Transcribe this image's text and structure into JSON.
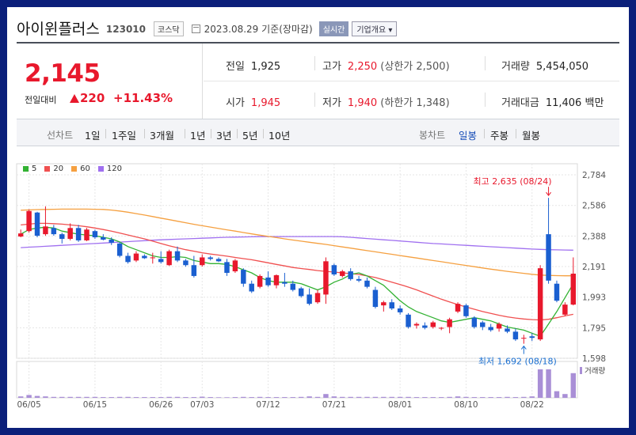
{
  "stock": {
    "name": "아이윈플러스",
    "code": "123010",
    "market": "코스닥",
    "date": "2023.08.29",
    "basis": "기준(장마감)",
    "live_label": "실시간",
    "info_label": "기업개요"
  },
  "price": {
    "current": "2,145",
    "change_label": "전일대비",
    "change": "220",
    "change_pct": "+11.43%"
  },
  "stats": {
    "prev_label": "전일",
    "prev": "1,925",
    "high_label": "고가",
    "high": "2,250",
    "upper_limit": "(상한가 2,500)",
    "volume_label": "거래량",
    "volume": "5,454,050",
    "open_label": "시가",
    "open": "1,945",
    "low_label": "저가",
    "low": "1,940",
    "lower_limit": "(하한가 1,348)",
    "amount_label": "거래대금",
    "amount": "11,406",
    "amount_unit": "백만"
  },
  "periods": {
    "line_label": "선차트",
    "line_items": [
      "1일",
      "1주일",
      "3개월",
      "1년",
      "3년",
      "5년",
      "10년"
    ],
    "candle_label": "봉차트",
    "candle_items": [
      "일봉",
      "주봉",
      "월봉"
    ],
    "active": "일봉"
  },
  "chart_data": {
    "type": "candlestick",
    "x_ticks": [
      "06/05",
      "06/15",
      "06/26",
      "07/03",
      "07/12",
      "07/21",
      "08/01",
      "08/10",
      "08/22"
    ],
    "x_tick_index": [
      1,
      9,
      17,
      22,
      30,
      38,
      46,
      54,
      62
    ],
    "y_ticks": [
      1598,
      1795,
      1993,
      2191,
      2388,
      2586,
      2784
    ],
    "ylim": [
      1598,
      2784
    ],
    "legend": [
      {
        "name": "5",
        "color": "#33b233"
      },
      {
        "name": "20",
        "color": "#f05050"
      },
      {
        "name": "60",
        "color": "#f5a040"
      },
      {
        "name": "120",
        "color": "#a070f0"
      }
    ],
    "annotations": {
      "high_label": "최고 2,635 (08/24)",
      "low_label": "최저 1,692 (08/18)",
      "high_color": "#e8182c",
      "low_color": "#1a6fd0"
    },
    "volume_label": "거래량",
    "up_color": "#e8182c",
    "down_color": "#1a5fd0",
    "candles": [
      [
        2385,
        2430,
        2380,
        2405
      ],
      [
        2420,
        2560,
        2410,
        2550
      ],
      [
        2540,
        2545,
        2380,
        2390
      ],
      [
        2400,
        2580,
        2390,
        2450
      ],
      [
        2440,
        2460,
        2390,
        2400
      ],
      [
        2400,
        2410,
        2340,
        2370
      ],
      [
        2370,
        2470,
        2360,
        2440
      ],
      [
        2440,
        2460,
        2350,
        2360
      ],
      [
        2360,
        2440,
        2355,
        2430
      ],
      [
        2420,
        2430,
        2370,
        2380
      ],
      [
        2380,
        2400,
        2360,
        2365
      ],
      [
        2365,
        2380,
        2330,
        2345
      ],
      [
        2340,
        2350,
        2250,
        2260
      ],
      [
        2260,
        2280,
        2210,
        2220
      ],
      [
        2230,
        2290,
        2220,
        2275
      ],
      [
        2260,
        2270,
        2240,
        2245
      ],
      [
        2245,
        2280,
        2210,
        2250
      ],
      [
        2240,
        2290,
        2210,
        2220
      ],
      [
        2200,
        2300,
        2195,
        2290
      ],
      [
        2290,
        2320,
        2220,
        2230
      ],
      [
        2230,
        2240,
        2190,
        2200
      ],
      [
        2200,
        2260,
        2120,
        2130
      ],
      [
        2200,
        2270,
        2190,
        2250
      ],
      [
        2250,
        2260,
        2230,
        2240
      ],
      [
        2240,
        2250,
        2220,
        2225
      ],
      [
        2220,
        2240,
        2130,
        2150
      ],
      [
        2160,
        2240,
        2150,
        2230
      ],
      [
        2170,
        2180,
        2060,
        2080
      ],
      [
        2080,
        2100,
        2020,
        2030
      ],
      [
        2060,
        2140,
        2050,
        2130
      ],
      [
        2120,
        2160,
        2060,
        2070
      ],
      [
        2070,
        2140,
        2050,
        2135
      ],
      [
        2090,
        2150,
        2060,
        2080
      ],
      [
        2080,
        2100,
        2030,
        2040
      ],
      [
        2050,
        2060,
        1990,
        2000
      ],
      [
        2010,
        2050,
        1940,
        1950
      ],
      [
        1960,
        2040,
        1950,
        2020
      ],
      [
        2010,
        2250,
        1950,
        2225
      ],
      [
        2200,
        2210,
        2130,
        2140
      ],
      [
        2130,
        2170,
        2120,
        2160
      ],
      [
        2160,
        2180,
        2100,
        2110
      ],
      [
        2110,
        2130,
        2090,
        2100
      ],
      [
        2100,
        2120,
        2050,
        2060
      ],
      [
        2040,
        2060,
        1920,
        1930
      ],
      [
        1940,
        1970,
        1900,
        1960
      ],
      [
        1960,
        1980,
        1910,
        1920
      ],
      [
        1920,
        1940,
        1880,
        1895
      ],
      [
        1880,
        1890,
        1790,
        1800
      ],
      [
        1810,
        1830,
        1790,
        1820
      ],
      [
        1810,
        1830,
        1785,
        1795
      ],
      [
        1800,
        1840,
        1790,
        1830
      ],
      [
        1790,
        1800,
        1780,
        1795
      ],
      [
        1800,
        1860,
        1760,
        1850
      ],
      [
        1900,
        1960,
        1890,
        1950
      ],
      [
        1940,
        1950,
        1860,
        1870
      ],
      [
        1860,
        1870,
        1790,
        1800
      ],
      [
        1830,
        1840,
        1780,
        1800
      ],
      [
        1800,
        1820,
        1770,
        1780
      ],
      [
        1790,
        1830,
        1770,
        1820
      ],
      [
        1790,
        1810,
        1760,
        1770
      ],
      [
        1770,
        1790,
        1710,
        1720
      ],
      [
        1730,
        1750,
        1692,
        1730
      ],
      [
        1740,
        1760,
        1710,
        1730
      ],
      [
        1720,
        2200,
        1710,
        2180
      ],
      [
        2400,
        2635,
        2080,
        2100
      ],
      [
        2080,
        2100,
        1960,
        1970
      ],
      [
        1880,
        1960,
        1870,
        1945
      ],
      [
        1945,
        2250,
        1940,
        2145
      ]
    ],
    "ma5": [
      2400,
      2430,
      2440,
      2445,
      2440,
      2420,
      2410,
      2400,
      2395,
      2390,
      2380,
      2370,
      2350,
      2320,
      2300,
      2280,
      2260,
      2250,
      2250,
      2255,
      2250,
      2230,
      2220,
      2210,
      2210,
      2205,
      2190,
      2170,
      2150,
      2120,
      2100,
      2090,
      2090,
      2090,
      2080,
      2060,
      2040,
      2060,
      2090,
      2110,
      2140,
      2150,
      2130,
      2100,
      2070,
      2020,
      1970,
      1930,
      1900,
      1880,
      1860,
      1840,
      1830,
      1840,
      1850,
      1860,
      1850,
      1840,
      1820,
      1800,
      1790,
      1780,
      1760,
      1740,
      1820,
      1900,
      1990,
      2080
    ],
    "ma20": [
      2460,
      2465,
      2470,
      2470,
      2468,
      2465,
      2460,
      2455,
      2448,
      2440,
      2430,
      2420,
      2408,
      2395,
      2382,
      2370,
      2355,
      2340,
      2325,
      2312,
      2300,
      2290,
      2280,
      2272,
      2265,
      2258,
      2250,
      2242,
      2235,
      2225,
      2215,
      2205,
      2195,
      2185,
      2178,
      2172,
      2165,
      2160,
      2155,
      2150,
      2145,
      2140,
      2130,
      2120,
      2105,
      2090,
      2075,
      2058,
      2040,
      2020,
      2000,
      1980,
      1962,
      1945,
      1930,
      1915,
      1900,
      1888,
      1876,
      1866,
      1858,
      1852,
      1848,
      1846,
      1850,
      1860,
      1872,
      1882
    ],
    "ma60": [
      2555,
      2557,
      2559,
      2560,
      2561,
      2562,
      2562,
      2562,
      2562,
      2561,
      2560,
      2556,
      2550,
      2542,
      2533,
      2524,
      2514,
      2504,
      2494,
      2484,
      2474,
      2464,
      2455,
      2446,
      2437,
      2428,
      2420,
      2411,
      2402,
      2394,
      2386,
      2378,
      2370,
      2362,
      2355,
      2348,
      2341,
      2334,
      2326,
      2318,
      2310,
      2302,
      2294,
      2286,
      2278,
      2270,
      2262,
      2254,
      2246,
      2238,
      2230,
      2222,
      2214,
      2206,
      2198,
      2190,
      2182,
      2174,
      2167,
      2160,
      2153,
      2147,
      2141,
      2136,
      2134,
      2132,
      2131,
      2131
    ],
    "ma120": [
      2313,
      2316,
      2319,
      2322,
      2325,
      2328,
      2331,
      2334,
      2337,
      2340,
      2343,
      2346,
      2349,
      2352,
      2355,
      2358,
      2361,
      2364,
      2366,
      2368,
      2370,
      2372,
      2374,
      2376,
      2378,
      2380,
      2381,
      2382,
      2383,
      2384,
      2385,
      2385,
      2385,
      2385,
      2385,
      2385,
      2385,
      2385,
      2385,
      2383,
      2380,
      2376,
      2372,
      2368,
      2364,
      2360,
      2356,
      2352,
      2348,
      2344,
      2340,
      2337,
      2334,
      2331,
      2328,
      2325,
      2322,
      2319,
      2316,
      2313,
      2310,
      2307,
      2304,
      2302,
      2300,
      2299,
      2298,
      2297
    ],
    "volume": [
      1.5,
      3.0,
      2.0,
      1.5,
      1.0,
      1.0,
      1.0,
      1.0,
      1.0,
      1.0,
      0.8,
      0.8,
      1.0,
      1.0,
      0.8,
      0.8,
      0.8,
      0.8,
      1.0,
      1.0,
      0.8,
      0.8,
      1.2,
      0.8,
      0.6,
      0.6,
      0.8,
      1.0,
      0.8,
      1.0,
      0.8,
      0.8,
      0.8,
      0.8,
      1.0,
      1.5,
      1.0,
      4.0,
      1.5,
      1.0,
      1.0,
      1.0,
      1.0,
      1.0,
      1.0,
      1.0,
      1.0,
      1.0,
      0.8,
      0.8,
      0.8,
      0.8,
      1.0,
      1.5,
      1.0,
      0.8,
      0.8,
      0.8,
      0.8,
      1.0,
      0.8,
      1.0,
      1.5,
      30.0,
      30.0,
      7.0,
      4.0,
      26.0
    ]
  }
}
